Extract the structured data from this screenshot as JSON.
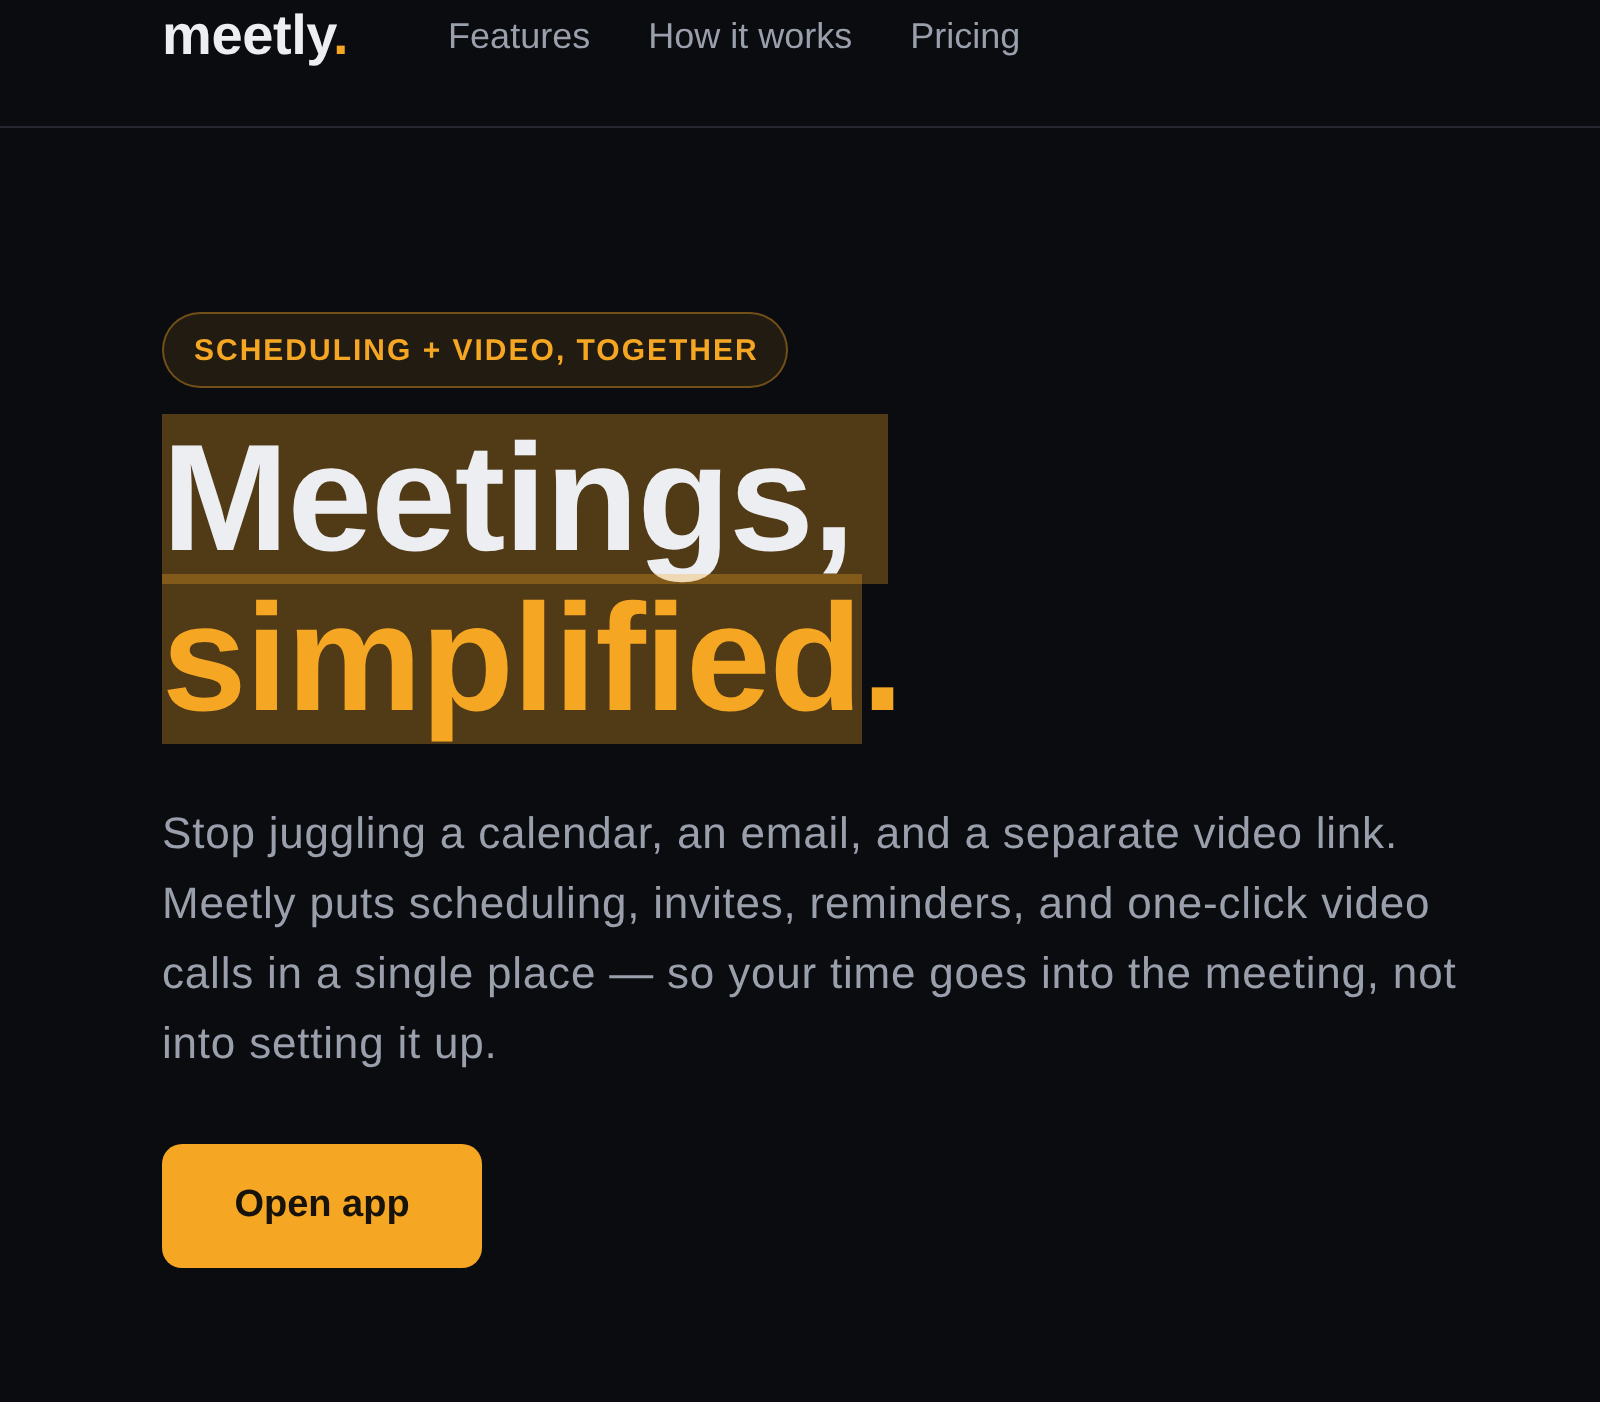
{
  "header": {
    "logo": {
      "name": "meetly",
      "mark": "."
    },
    "nav": [
      "Features",
      "How it works",
      "Pricing"
    ]
  },
  "hero": {
    "badge": "SCHEDULING + VIDEO, TOGETHER",
    "headline": [
      [
        {
          "text": "Meetings,",
          "accent": false,
          "selected": true
        }
      ],
      [
        {
          "text": "simplified",
          "accent": true,
          "selected": true
        },
        {
          "text": ".",
          "accent": true,
          "selected": false
        }
      ]
    ],
    "description": "Stop juggling a calendar, an email, and a separate video link. Meetly puts scheduling, invites, reminders, and one-click video calls in a single place — so your time goes into the meeting, not into setting it up.",
    "button": "Open app"
  }
}
